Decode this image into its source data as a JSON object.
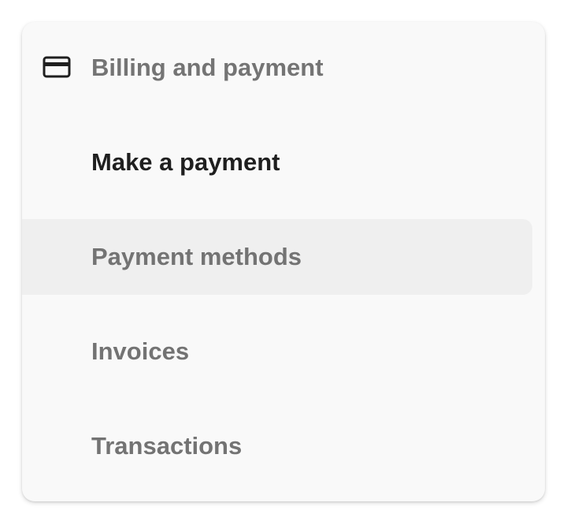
{
  "menu": {
    "header": {
      "icon": "credit-card-icon",
      "label": "Billing and payment"
    },
    "items": [
      {
        "label": "Make a payment",
        "state": "active"
      },
      {
        "label": "Payment methods",
        "state": "hovered"
      },
      {
        "label": "Invoices",
        "state": "default"
      },
      {
        "label": "Transactions",
        "state": "default"
      }
    ]
  },
  "colors": {
    "card_background": "#f9f9f9",
    "hover_background": "#efefef",
    "active_text": "#1f1f1f",
    "muted_text": "#737373",
    "icon": "#1f1f1f"
  }
}
